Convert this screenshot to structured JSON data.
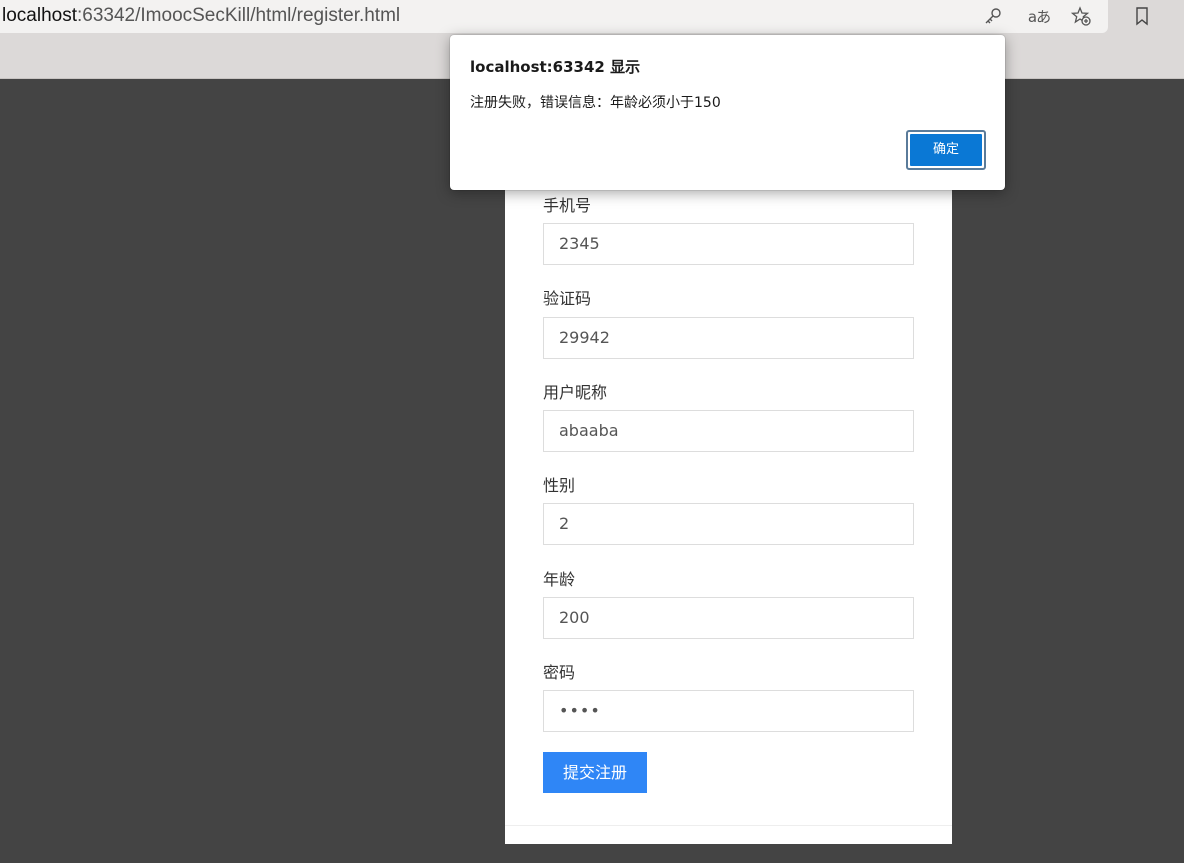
{
  "browser": {
    "url_host": "localhost",
    "url_rest": ":63342/ImoocSecKill/html/register.html",
    "icons": [
      "key-icon",
      "read-aloud-icon",
      "add-favorite-icon",
      "favorites-icon"
    ],
    "translate_glyph": "aあ"
  },
  "form": {
    "fields": [
      {
        "label": "手机号",
        "value": "2345"
      },
      {
        "label": "验证码",
        "value": "29942"
      },
      {
        "label": "用户昵称",
        "value": "abaaba"
      },
      {
        "label": "性别",
        "value": "2"
      },
      {
        "label": "年龄",
        "value": "200"
      },
      {
        "label": "密码",
        "value": "••••"
      }
    ],
    "submit_label": "提交注册"
  },
  "dialog": {
    "title": "localhost:63342 显示",
    "message": "注册失败，错误信息：年龄必须小于150",
    "ok_label": "确定"
  },
  "colors": {
    "backdrop": "#444444",
    "submit_button": "#2f86f6",
    "dialog_ok": "#0a78d5"
  }
}
